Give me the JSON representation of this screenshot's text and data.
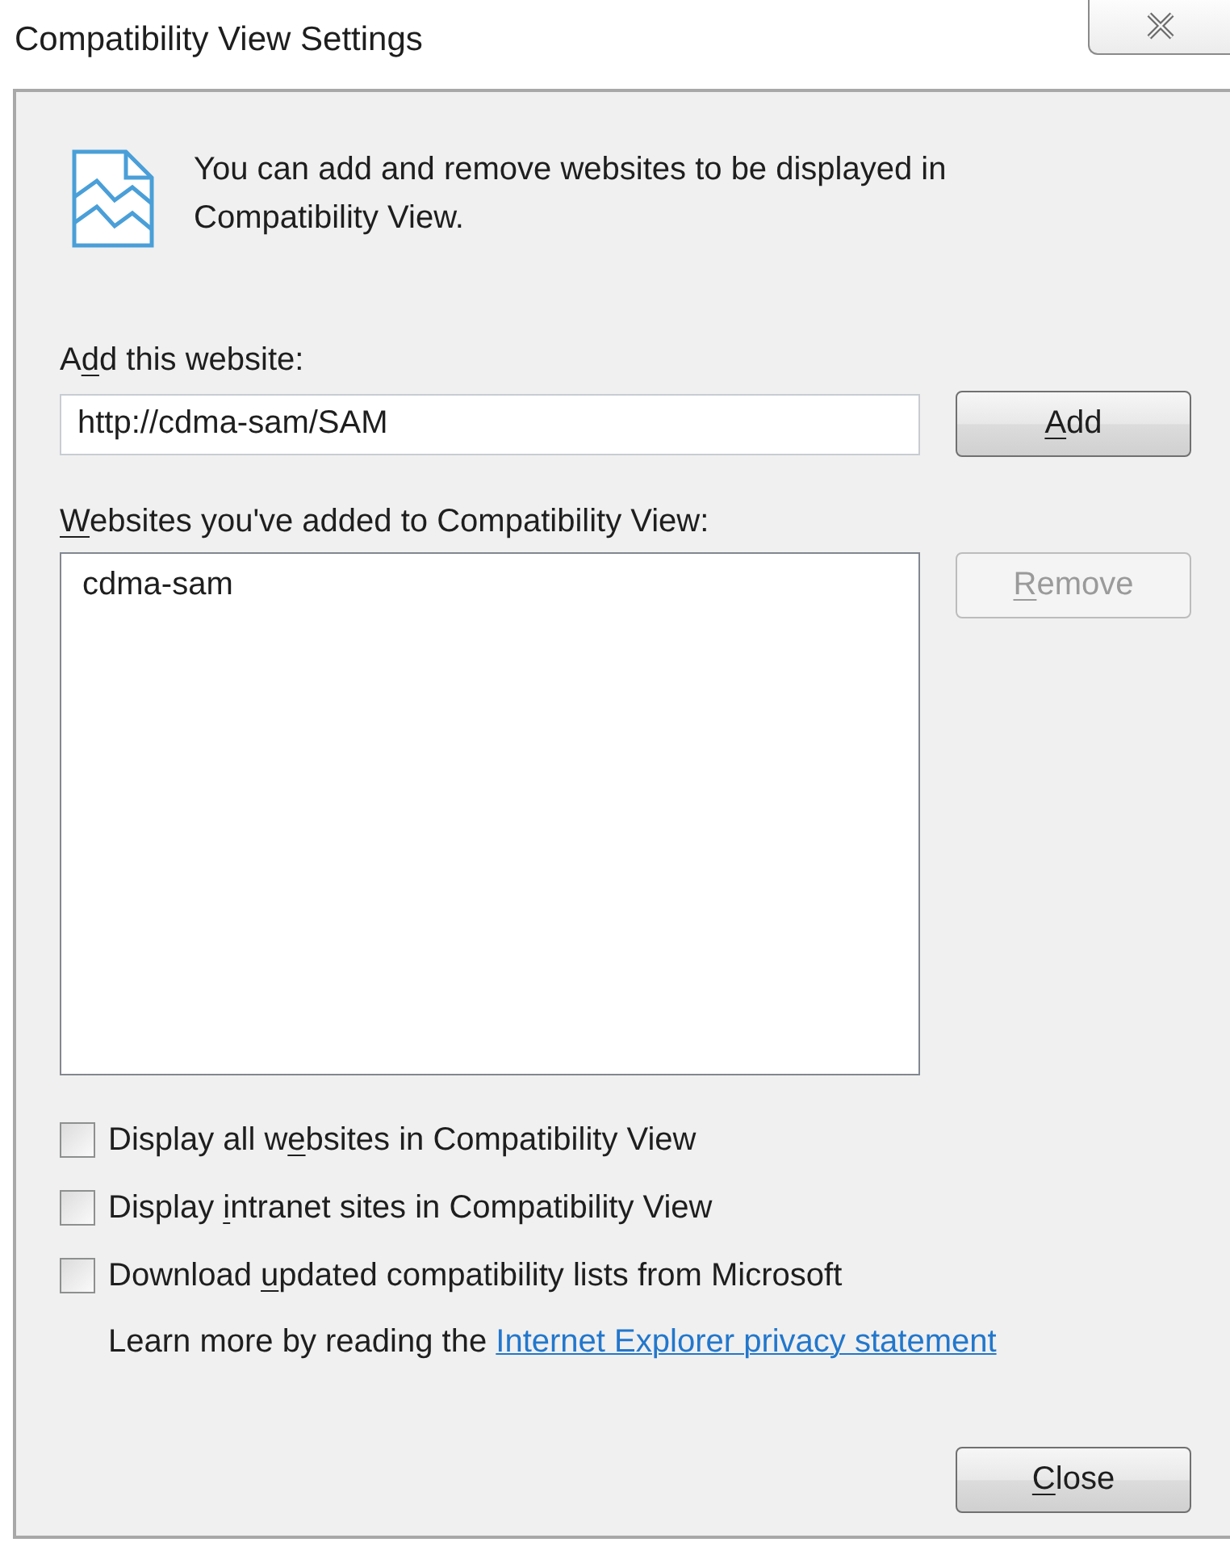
{
  "window": {
    "title": "Compatibility View Settings"
  },
  "intro": "You can add and remove websites to be displayed in Compatibility View.",
  "add_field": {
    "label": {
      "before": "A",
      "key": "d",
      "after": "d this website:"
    },
    "value": "http://cdma-sam/SAM"
  },
  "add_button": {
    "label": {
      "key": "A",
      "after": "dd"
    },
    "disabled": false
  },
  "websites": {
    "label": {
      "key": "W",
      "after": "ebsites you've added to Compatibility View:"
    },
    "items": [
      {
        "text": "cdma-sam",
        "selected": false
      }
    ]
  },
  "remove_button": {
    "label": {
      "key": "R",
      "after": "emove"
    },
    "disabled": true
  },
  "options": [
    {
      "label": {
        "before": "Display all w",
        "key": "e",
        "after": "bsites in Compatibility View"
      },
      "checked": false
    },
    {
      "label": {
        "before": "Display ",
        "key": "i",
        "after": "ntranet sites in Compatibility View"
      },
      "checked": false
    },
    {
      "label": {
        "before": "Download ",
        "key": "u",
        "after": "pdated compatibility lists from Microsoft"
      },
      "checked": false
    }
  ],
  "privacy": {
    "text": "Learn more by reading the",
    "link": "Internet Explorer privacy statement"
  },
  "close_button": {
    "label": {
      "key": "C",
      "after": "lose"
    },
    "disabled": false
  }
}
